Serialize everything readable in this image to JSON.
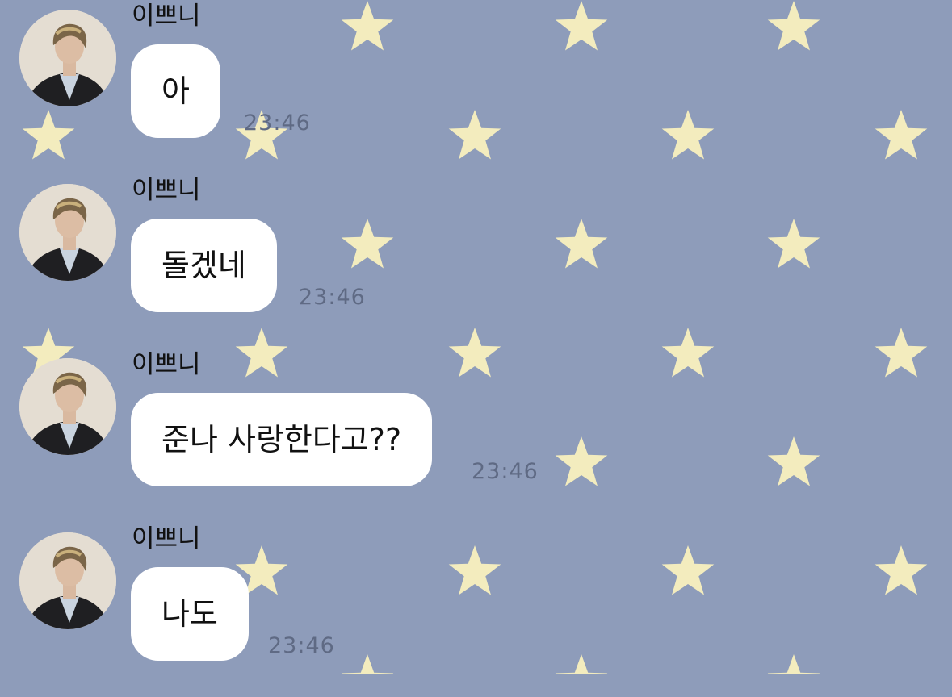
{
  "chat": {
    "colors": {
      "background": "#8e9cba",
      "star": "#f3ecbe",
      "bubble": "#ffffff",
      "text": "#111111",
      "time": "#5f6a84"
    },
    "messages": [
      {
        "sender": "이쁘니",
        "text": "아",
        "time": "23:46"
      },
      {
        "sender": "이쁘니",
        "text": "돌겠네",
        "time": "23:46"
      },
      {
        "sender": "이쁘니",
        "text": "준나 사랑한다고??",
        "time": "23:46"
      },
      {
        "sender": "이쁘니",
        "text": "나도",
        "time": "23:46"
      }
    ]
  }
}
